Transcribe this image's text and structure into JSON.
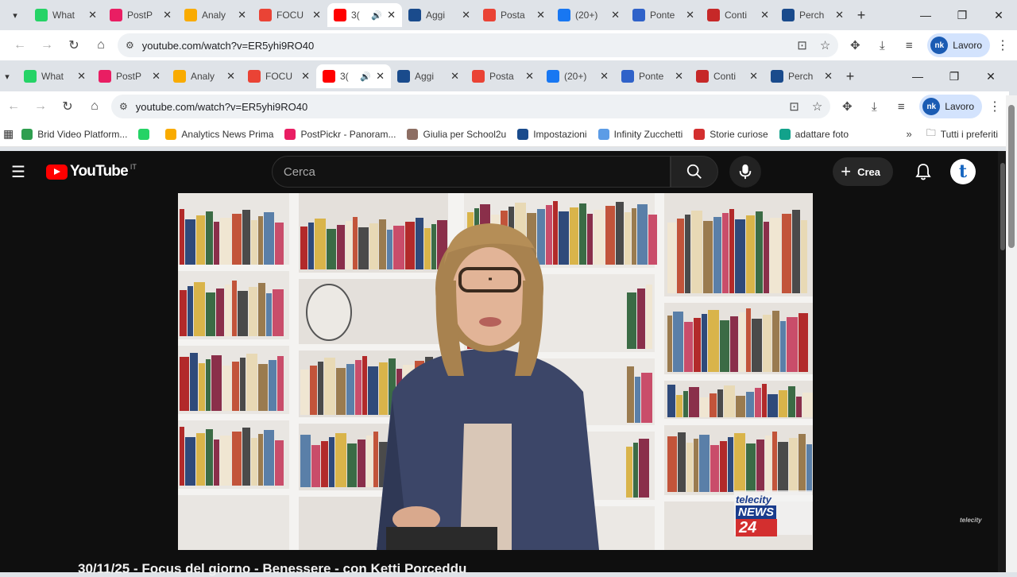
{
  "outer": {
    "tabs": [
      {
        "title": "What",
        "fav": "whatsapp-icon",
        "color": "#25d366"
      },
      {
        "title": "PostP",
        "fav": "postpickr-icon",
        "color": "#e91e63"
      },
      {
        "title": "Analy",
        "fav": "analytics-icon",
        "color": "#f9ab00"
      },
      {
        "title": "FOCU",
        "fav": "gmail-icon",
        "color": "#ea4335"
      },
      {
        "title": "3(",
        "fav": "youtube-icon",
        "color": "#ff0000",
        "active": true
      },
      {
        "title": "Aggi",
        "fav": "news-icon",
        "color": "#1a4b8c"
      },
      {
        "title": "Posta",
        "fav": "gmail-icon",
        "color": "#ea4335"
      },
      {
        "title": "(20+)",
        "fav": "facebook-icon",
        "color": "#1877f2"
      },
      {
        "title": "Ponte",
        "fav": "ponte-icon",
        "color": "#2f62c9"
      },
      {
        "title": "Conti",
        "fav": "conti-icon",
        "color": "#c62828"
      },
      {
        "title": "Perch",
        "fav": "news-icon",
        "color": "#1a4b8c"
      }
    ],
    "url": "youtube.com/watch?v=ER5yhi9RO40"
  },
  "inner": {
    "tabs": [
      {
        "title": "What",
        "fav": "whatsapp-icon",
        "color": "#25d366"
      },
      {
        "title": "PostP",
        "fav": "postpickr-icon",
        "color": "#e91e63"
      },
      {
        "title": "Analy",
        "fav": "analytics-icon",
        "color": "#f9ab00"
      },
      {
        "title": "FOCU",
        "fav": "gmail-icon",
        "color": "#ea4335"
      },
      {
        "title": "3(",
        "fav": "youtube-icon",
        "color": "#ff0000",
        "active": true
      },
      {
        "title": "Aggi",
        "fav": "news-icon",
        "color": "#1a4b8c"
      },
      {
        "title": "Posta",
        "fav": "gmail-icon",
        "color": "#ea4335"
      },
      {
        "title": "(20+)",
        "fav": "facebook-icon",
        "color": "#1877f2"
      },
      {
        "title": "Ponte",
        "fav": "ponte-icon",
        "color": "#2f62c9"
      },
      {
        "title": "Conti",
        "fav": "conti-icon",
        "color": "#c62828"
      },
      {
        "title": "Perch",
        "fav": "news-icon",
        "color": "#1a4b8c"
      }
    ],
    "url": "youtube.com/watch?v=ER5yhi9RO40"
  },
  "profile": {
    "label": "Lavoro"
  },
  "bookmarks": [
    {
      "label": "Brid Video Platform...",
      "icon": "brid-icon",
      "color": "#2e9e4f"
    },
    {
      "label": "",
      "icon": "whatsapp-icon",
      "color": "#25d366"
    },
    {
      "label": "Analytics News Prima",
      "icon": "analytics-icon",
      "color": "#f9ab00"
    },
    {
      "label": "PostPickr - Panoram...",
      "icon": "postpickr-icon",
      "color": "#e91e63"
    },
    {
      "label": "Giulia per School2u",
      "icon": "giulia-icon",
      "color": "#8d6e63"
    },
    {
      "label": "Impostazioni",
      "icon": "news-icon",
      "color": "#1a4b8c"
    },
    {
      "label": "Infinity Zucchetti",
      "icon": "infinity-icon",
      "color": "#5c9ce6"
    },
    {
      "label": "Storie curiose",
      "icon": "storie-icon",
      "color": "#d32f2f"
    },
    {
      "label": "adattare foto",
      "icon": "foto-icon",
      "color": "#12a28b"
    }
  ],
  "bookmarks_all": "Tutti i preferiti",
  "youtube": {
    "wordmark": "YouTube",
    "country": "IT",
    "search_placeholder": "Cerca",
    "create_label": "Crea",
    "avatar_letter": "t",
    "video_title": "30/11/25 - Focus del giorno - Benessere - con Ketti Porceddu",
    "watermark_top": "telecity",
    "watermark_mid": "NEWS",
    "watermark_num": "24",
    "corner_mark": "telecity"
  }
}
